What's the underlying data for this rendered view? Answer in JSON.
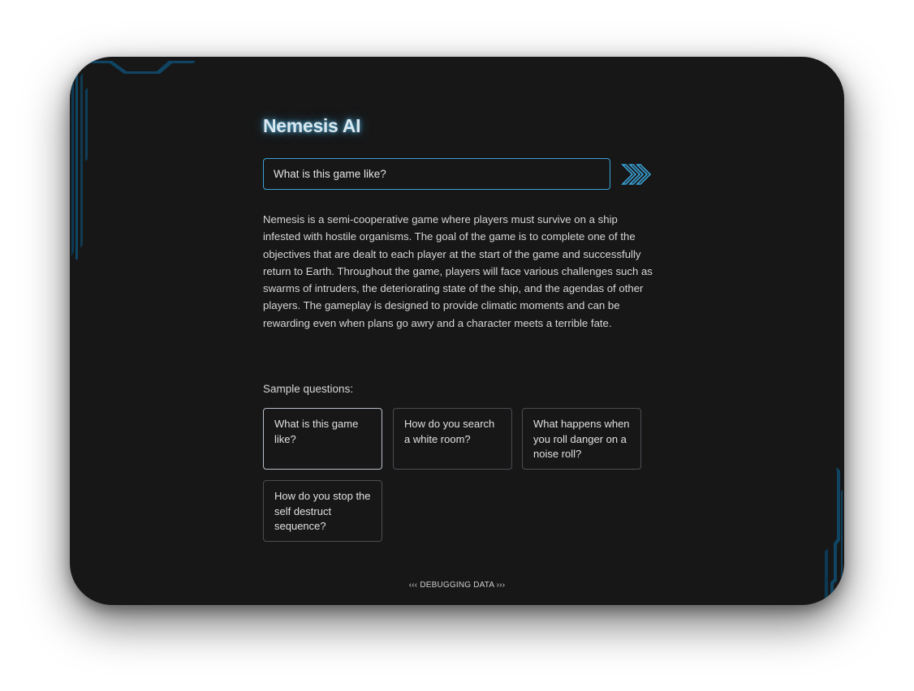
{
  "app": {
    "title": "Nemesis AI"
  },
  "search": {
    "value": "What is this game like?",
    "placeholder": "",
    "submit_icon": "triple-chevron-right-icon"
  },
  "answer": {
    "text": "Nemesis is a semi-cooperative game where players must survive on a ship infested with hostile organisms. The goal of the game is to complete one of the objectives that are dealt to each player at the start of the game and successfully return to Earth. Throughout the game, players will face various challenges such as swarms of intruders, the deteriorating state of the ship, and the agendas of other players. The gameplay is designed to provide climatic moments and can be rewarding even when plans go awry and a character meets a terrible fate."
  },
  "samples": {
    "label": "Sample questions:",
    "questions": [
      "What is this game like?",
      "How do you search a white room?",
      "What happens when you roll danger on a noise roll?",
      "How do you stop the self destruct sequence?"
    ]
  },
  "footer": {
    "left_chevrons": "‹‹‹",
    "debug_label": "DEBUGGING DATA",
    "right_chevrons": "›››"
  },
  "colors": {
    "background": "#171717",
    "accent": "#3aa2d6",
    "frame_decoration": "#0e3a54",
    "text": "#d6d6d6",
    "title_glow": "#5abeeb"
  }
}
